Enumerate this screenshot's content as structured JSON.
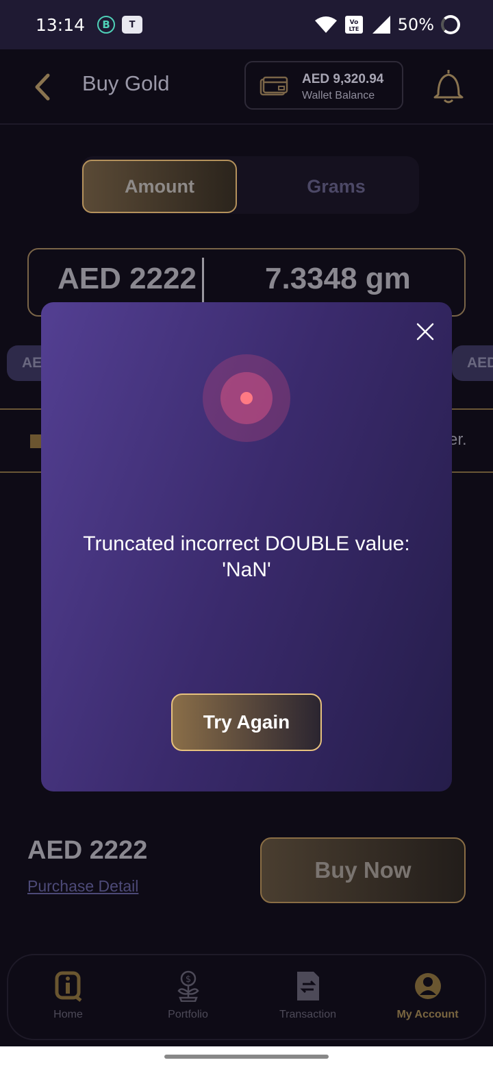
{
  "status_bar": {
    "time": "13:14",
    "b_icon": "B",
    "teams_icon": "T",
    "battery": "50%"
  },
  "header": {
    "title": "Buy Gold",
    "wallet_amount": "AED 9,320.94",
    "wallet_label": "Wallet Balance"
  },
  "toggle": {
    "amount_label": "Amount",
    "grams_label": "Grams",
    "selected": "Amount"
  },
  "input": {
    "amount_value": "AED  2222",
    "grams_value": "7.3348  gm"
  },
  "chips": {
    "left": "AE",
    "right": "AED"
  },
  "promo": {
    "partial_text": "er."
  },
  "summary": {
    "total": "AED 2222",
    "purchase_detail_link": "Purchase Detail",
    "buy_button": "Buy Now"
  },
  "bottom_nav": {
    "items": [
      {
        "label": "Home",
        "icon": "home-logo-icon",
        "active": false
      },
      {
        "label": "Portfolio",
        "icon": "money-plant-icon",
        "active": false
      },
      {
        "label": "Transaction",
        "icon": "receipt-icon",
        "active": false
      },
      {
        "label": "My Account",
        "icon": "account-circle-icon",
        "active": true
      }
    ]
  },
  "modal": {
    "message": "Truncated incorrect DOUBLE value: 'NaN'",
    "button": "Try Again"
  },
  "colors": {
    "gold_accent": "#e7c27e",
    "modal_start": "#533f92",
    "modal_end": "#251d4a",
    "error_dot": "#ff7a84"
  }
}
